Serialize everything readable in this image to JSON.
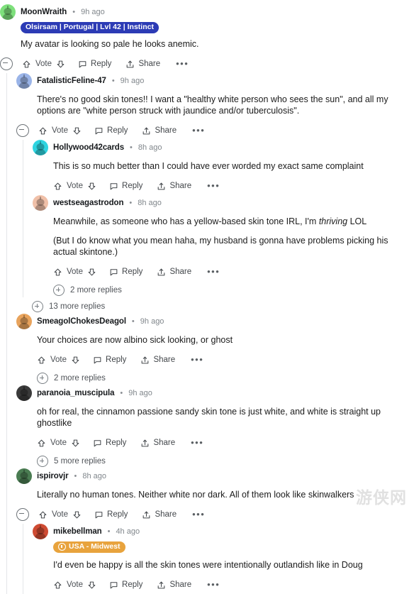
{
  "labels": {
    "vote": "Vote",
    "reply": "Reply",
    "share": "Share",
    "more_actions": "•••",
    "dot": "•"
  },
  "watermark": "游侠网",
  "comments": [
    {
      "id": "c1",
      "username": "MoonWraith",
      "timestamp": "9h ago",
      "avatar_color": "#7ee07c",
      "flair": {
        "text": "Olsirsam | Portugal | Lvl 42 | Instinct",
        "style": "blue",
        "has_icon": false
      },
      "paragraphs": [
        "My avatar is looking so pale he looks anemic."
      ],
      "has_collapse": true,
      "more_replies": null,
      "replies": [
        {
          "id": "c2",
          "username": "FatalisticFeline-47",
          "timestamp": "9h ago",
          "avatar_color": "#9ab4e8",
          "flair": null,
          "paragraphs": [
            "There's no good skin tones!! I want a \"healthy white person who sees the sun\", and all my options are \"white person struck with jaundice and/or tuberculosis\"."
          ],
          "has_collapse": true,
          "more_replies": "13 more replies",
          "replies": [
            {
              "id": "c3",
              "username": "Hollywood42cards",
              "timestamp": "8h ago",
              "avatar_color": "#2fd4e0",
              "flair": null,
              "paragraphs": [
                "This is so much better than I could have ever worded my exact same complaint"
              ],
              "has_collapse": false,
              "more_replies": null,
              "replies": []
            },
            {
              "id": "c4",
              "username": "westseagastrodon",
              "timestamp": "8h ago",
              "avatar_color": "#f0c0a8",
              "flair": null,
              "paragraphs": [
                "Meanwhile, as someone who has a yellow-based skin tone IRL, I'm <em>thriving</em> LOL",
                "(But I do know what you mean haha, my husband is gonna have problems picking his actual skintone.)"
              ],
              "has_collapse": false,
              "more_replies": "2 more replies",
              "replies": []
            }
          ]
        },
        {
          "id": "c5",
          "username": "SmeagolChokesDeagol",
          "timestamp": "9h ago",
          "avatar_color": "#e8a35c",
          "flair": null,
          "paragraphs": [
            "Your choices are now albino sick looking, or ghost"
          ],
          "has_collapse": false,
          "more_replies": "2 more replies",
          "replies": []
        },
        {
          "id": "c6",
          "username": "paranoia_muscipula",
          "timestamp": "9h ago",
          "avatar_color": "#3a3a3a",
          "flair": null,
          "paragraphs": [
            "oh for real, the cinnamon passione sandy skin tone is just white, and white is straight up ghostlike"
          ],
          "has_collapse": false,
          "more_replies": "5 more replies",
          "replies": []
        },
        {
          "id": "c7",
          "username": "ispirovjr",
          "timestamp": "8h ago",
          "avatar_color": "#4a7c52",
          "flair": null,
          "paragraphs": [
            "Literally no human tones. Neither white nor dark. All of them look like skinwalkers"
          ],
          "has_collapse": true,
          "more_replies": null,
          "replies": [
            {
              "id": "c8",
              "username": "mikebellman",
              "timestamp": "4h ago",
              "avatar_color": "#cf4b33",
              "flair": {
                "text": "USA - Midwest",
                "style": "gold",
                "has_icon": true
              },
              "paragraphs": [
                "I'd even be happy is all the skin tones were intentionally outlandish like in Doug"
              ],
              "has_collapse": false,
              "more_replies": null,
              "replies": []
            }
          ]
        }
      ]
    }
  ]
}
